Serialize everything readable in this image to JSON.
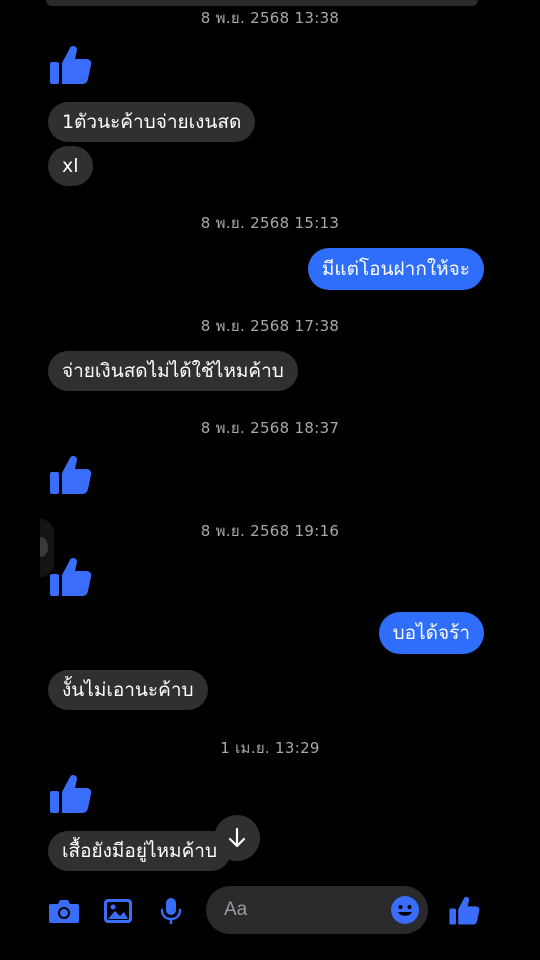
{
  "timestamps": [
    "8 พ.ย. 2568 13:38",
    "8 พ.ย. 2568 15:13",
    "8 พ.ย. 2568 17:38",
    "8 พ.ย. 2568 18:37",
    "8 พ.ย. 2568 19:16",
    "1 เม.ย. 13:29"
  ],
  "messages": {
    "in_1": "1ตัวนะค้าบจ่ายเงนสด",
    "in_2": "xl",
    "out_1": "มีแต่โอนฝากให้จะ",
    "in_3": "จ่ายเงินสดไม่ได้ใช้ไหมค้าบ",
    "out_2": "บอได้จร้า",
    "in_4": "งั้นไม่เอานะค้าบ",
    "in_5": "เสื้อยังมีอยู่ไหมค้าบ"
  },
  "composer": {
    "placeholder": "Aa",
    "icons": [
      "camera-icon",
      "gallery-icon",
      "microphone-icon",
      "emoji-icon",
      "thumbs-up-icon"
    ]
  },
  "colors": {
    "background": "#000000",
    "incoming_bubble": "#303033",
    "outgoing_bubble": "#2f6dfb",
    "accent": "#3b6dfb",
    "timestamp": "#a8a8ad"
  }
}
